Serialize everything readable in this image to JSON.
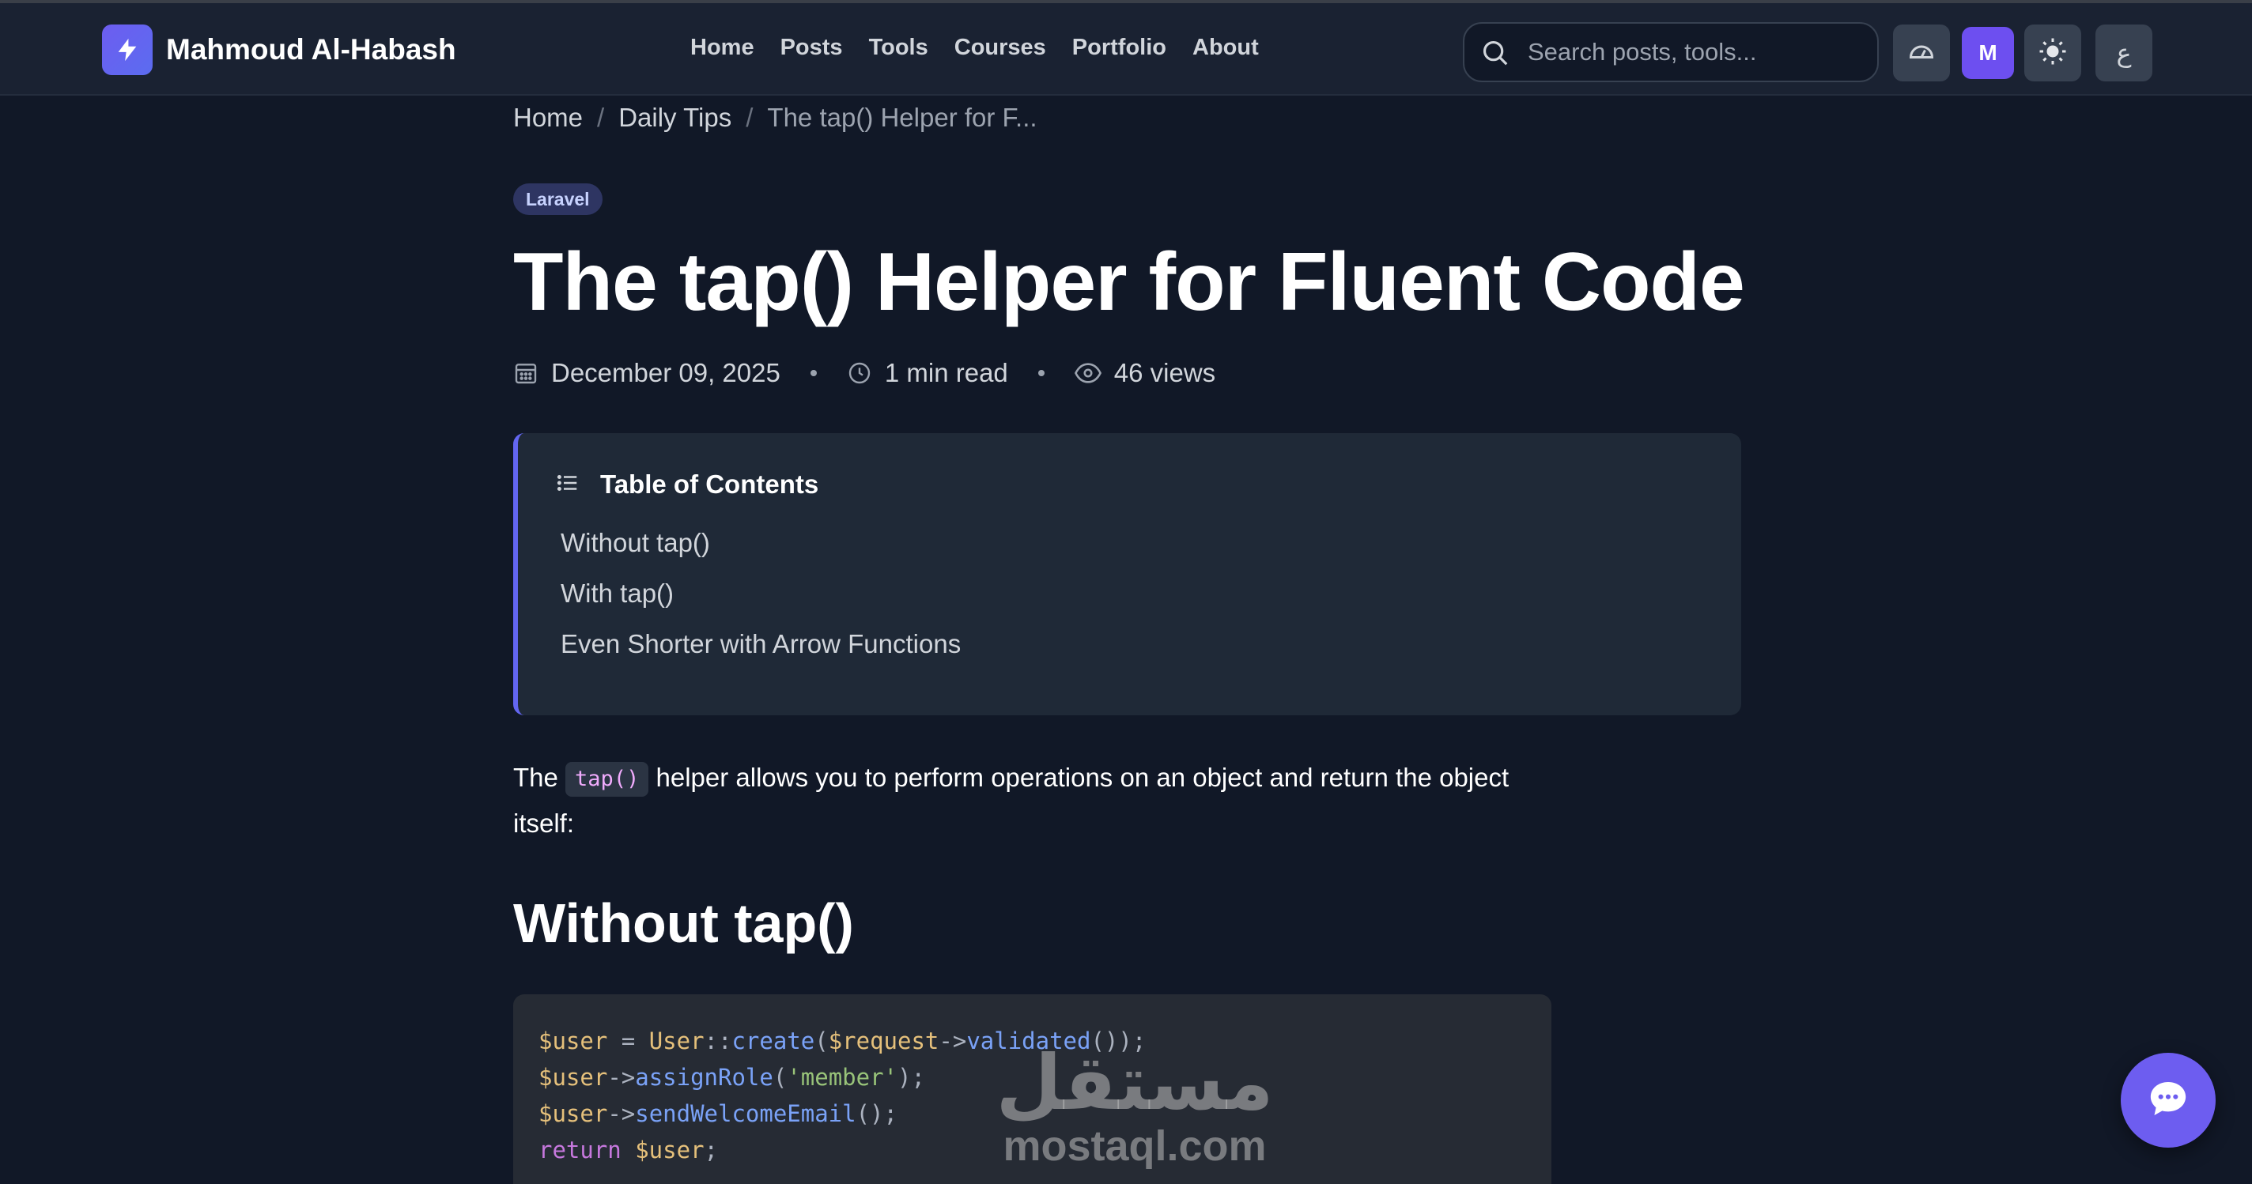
{
  "header": {
    "brand_name": "Mahmoud Al-Habash",
    "nav": [
      "Home",
      "Posts",
      "Tools",
      "Courses",
      "Portfolio",
      "About"
    ],
    "search_placeholder": "Search posts, tools...",
    "avatar_initial": "M",
    "lang_label": "ع"
  },
  "breadcrumb": {
    "home": "Home",
    "section": "Daily Tips",
    "current": "The tap() Helper for F..."
  },
  "post": {
    "tag": "Laravel",
    "title": "The tap() Helper for Fluent Code",
    "date": "December 09, 2025",
    "read_time": "1 min read",
    "views": "46 views"
  },
  "toc": {
    "title": "Table of Contents",
    "items": [
      "Without tap()",
      "With tap()",
      "Even Shorter with Arrow Functions"
    ]
  },
  "body": {
    "intro_before": "The",
    "intro_code": "tap()",
    "intro_after": "helper allows you to perform operations on an object and return the object itself:",
    "heading": "Without tap()"
  },
  "code": {
    "line1": {
      "var": "$user",
      "op": " = ",
      "cls": "User",
      "sep": "::",
      "fn": "create",
      "open": "(",
      "arg": "$request",
      "arrow": "->",
      "fn2": "validated",
      "close": "());"
    },
    "line2": {
      "var": "$user",
      "arrow": "->",
      "fn": "assignRole",
      "open": "(",
      "str": "'member'",
      "close": ");"
    },
    "line3": {
      "var": "$user",
      "arrow": "->",
      "fn": "sendWelcomeEmail",
      "close": "();"
    },
    "line4": {
      "kw": "return",
      "var": " $user",
      "close": ";"
    }
  },
  "watermark": {
    "arabic": "مستقل",
    "latin": "mostaql.com"
  },
  "colors": {
    "accent": "#6366f1",
    "background": "#111827",
    "header": "#1a2232"
  }
}
